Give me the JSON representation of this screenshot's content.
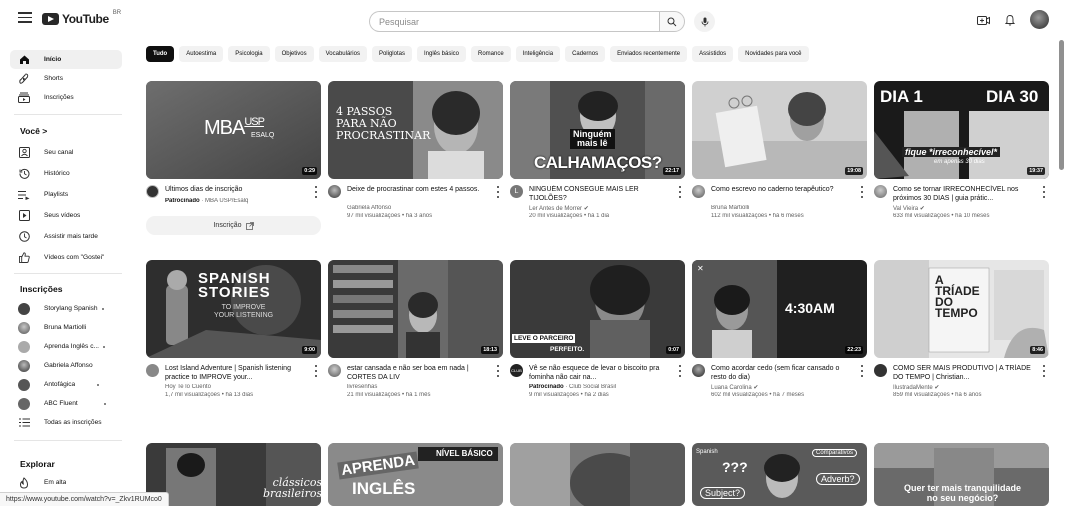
{
  "header": {
    "logo_text": "YouTube",
    "region": "BR",
    "search_placeholder": "Pesquisar"
  },
  "sidebar": {
    "main": [
      {
        "label": "Início",
        "icon": "home-icon",
        "active": true
      },
      {
        "label": "Shorts",
        "icon": "shorts-icon"
      },
      {
        "label": "Inscrições",
        "icon": "subscriptions-icon"
      }
    ],
    "you_header": "Você  >",
    "you": [
      {
        "label": "Seu canal",
        "icon": "channel-icon"
      },
      {
        "label": "Histórico",
        "icon": "history-icon"
      },
      {
        "label": "Playlists",
        "icon": "playlists-icon"
      },
      {
        "label": "Seus vídeos",
        "icon": "your-videos-icon"
      },
      {
        "label": "Assistir mais tarde",
        "icon": "watch-later-icon"
      },
      {
        "label": "Vídeos com \"Gostei\"",
        "icon": "like-icon"
      }
    ],
    "subs_header": "Inscrições",
    "subs": [
      {
        "label": "Storylang Spanish",
        "dot": true
      },
      {
        "label": "Bruna Martiolli"
      },
      {
        "label": "Aprenda Inglês c...",
        "dot": true
      },
      {
        "label": "Gabriela Affonso"
      },
      {
        "label": "Antofágica",
        "dot": true
      },
      {
        "label": "ABC Fluent",
        "dot": true
      },
      {
        "label": "Todas as inscrições"
      }
    ],
    "explore_header": "Explorar",
    "explore": [
      {
        "label": "Em alta",
        "icon": "trending-icon"
      }
    ]
  },
  "chips": [
    "Tudo",
    "Autoestima",
    "Psicologia",
    "Objetivos",
    "Vocabulários",
    "Poliglotas",
    "Inglês básico",
    "Romance",
    "Inteligência",
    "Cadernos",
    "Enviados recentemente",
    "Assistidos",
    "Novidades para você"
  ],
  "videos_row1": [
    {
      "title": "Últimos dias de inscrição",
      "channel": "MBA USP/Esalq",
      "sponsored": "Patrocinado",
      "meta": "",
      "duration": "0:29",
      "ad_button": "Inscrição",
      "thumb_text": "MBAUSP ESALQ"
    },
    {
      "title": "Deixe de procrastinar com estes 4 passos.",
      "channel": "Gabriela Affonso",
      "meta": "97 mil visualizações • há 3 anos",
      "duration": "",
      "thumb_text": "4 PASSOS PARA NÃO PROCRASTINAR"
    },
    {
      "title": "NINGUÉM CONSEGUE MAIS LER TIJOLÕES?",
      "channel": "Ler Antes de Morrer ✔",
      "meta": "20 mil visualizações • há 1 dia",
      "duration": "22:17",
      "thumb_text": "Ninguém mais lê CALHAMAÇOS?"
    },
    {
      "title": "Como escrevo no caderno terapêutico?",
      "channel": "Bruna Martiolli",
      "meta": "112 mil visualizações • há 6 meses",
      "duration": "19:08",
      "thumb_text": ""
    },
    {
      "title": "Como se tornar IRRECONHECÍVEL nos próximos 30 DIAS | guia prátic...",
      "channel": "Val Vieira ✔",
      "meta": "633 mil visualizações • há 10 meses",
      "duration": "19:37",
      "thumb_text": "DIA 1 DIA 30 fique *irreconhecível* em apenas 30 dias"
    }
  ],
  "videos_row2": [
    {
      "title": "Lost Island Adventure | Spanish listening practice to IMPROVE your...",
      "channel": "Hoy Te lo Cuento",
      "meta": "1,7 mil visualizações • há 13 dias",
      "duration": "9:00",
      "thumb_text": "SPANISH STORIES TO IMPROVE YOUR LISTENING"
    },
    {
      "title": "estar cansada e não ser boa em nada | CORTES DA LIV",
      "channel": "livresenhas",
      "meta": "21 mil visualizações • há 1 mês",
      "duration": "18:13",
      "thumb_text": ""
    },
    {
      "title": "Vê se não esquece de levar o biscoito pra fominha não cair na...",
      "channel": "Club Social Brasil",
      "sponsored": "Patrocinado",
      "meta": "9 mil visualizações • há 2 dias",
      "duration": "0:07",
      "thumb_text": "LEVE O PARCEIRO PERFEITO."
    },
    {
      "title": "Como acordar cedo (sem ficar cansado o resto do dia)",
      "channel": "Luana Carolina ✔",
      "meta": "602 mil visualizações • há 7 meses",
      "duration": "22:23",
      "thumb_text": "4:30AM"
    },
    {
      "title": "COMO SER MAIS PRODUTIVO | A TRÍADE DO TEMPO | Christian...",
      "channel": "IlustradaMente ✔",
      "meta": "859 mil visualizações • há 6 anos",
      "duration": "8:46",
      "thumb_text": "A TRÍADE DO TEMPO"
    }
  ],
  "videos_row3": [
    {
      "thumb_text": "clássicos brasileiros"
    },
    {
      "thumb_text": "APRENDA INGLÊS NÍVEL BÁSICO"
    },
    {
      "thumb_text": ""
    },
    {
      "thumb_text": "Spanish ??? Comparativos Subject? Adverb?"
    },
    {
      "thumb_text": "Quer ter mais tranquilidade no seu negócio?"
    }
  ],
  "status_url": "https://www.youtube.com/watch?v=_Zkv1RUMco0"
}
